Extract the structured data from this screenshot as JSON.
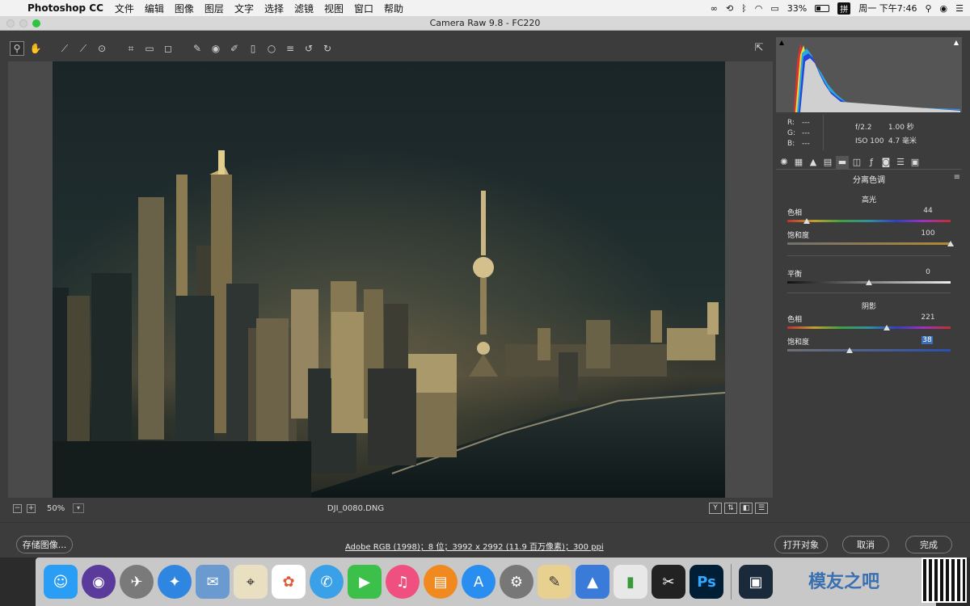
{
  "menubar": {
    "app_name": "Photoshop CC",
    "items": [
      "文件",
      "编辑",
      "图像",
      "图层",
      "文字",
      "选择",
      "滤镜",
      "视图",
      "窗口",
      "帮助"
    ],
    "battery": "33%",
    "ime": "拼",
    "clock": "周一 下午7:46"
  },
  "window": {
    "title": "Camera Raw 9.8  -  FC220"
  },
  "status": {
    "zoom": "50%",
    "filename": "DJI_0080.DNG",
    "view_icons": [
      "Y",
      "⇅",
      "◧",
      "☰"
    ]
  },
  "bottom": {
    "save_label": "存储图像...",
    "workflow": "Adobe RGB (1998)；8 位；3992 x 2992 (11.9 百万像素)；300 ppi",
    "open_label": "打开对象",
    "cancel_label": "取消",
    "done_label": "完成"
  },
  "readout": {
    "r_label": "R:",
    "g_label": "G:",
    "b_label": "B:",
    "r": "---",
    "g": "---",
    "b": "---",
    "aperture": "f/2.2",
    "shutter": "1.00 秒",
    "iso": "ISO 100",
    "focal": "4.7 毫米"
  },
  "panel": {
    "title": "分离色调",
    "highlights": {
      "title": "高光",
      "hue_label": "色相",
      "hue_value": "44",
      "hue_pct": 0.12,
      "sat_label": "饱和度",
      "sat_value": "100",
      "sat_pct": 1.0
    },
    "balance": {
      "label": "平衡",
      "value": "0",
      "pct": 0.5
    },
    "shadows": {
      "title": "阴影",
      "hue_label": "色相",
      "hue_value": "221",
      "hue_pct": 0.61,
      "sat_label": "饱和度",
      "sat_value": "38",
      "sat_pct": 0.38
    }
  }
}
